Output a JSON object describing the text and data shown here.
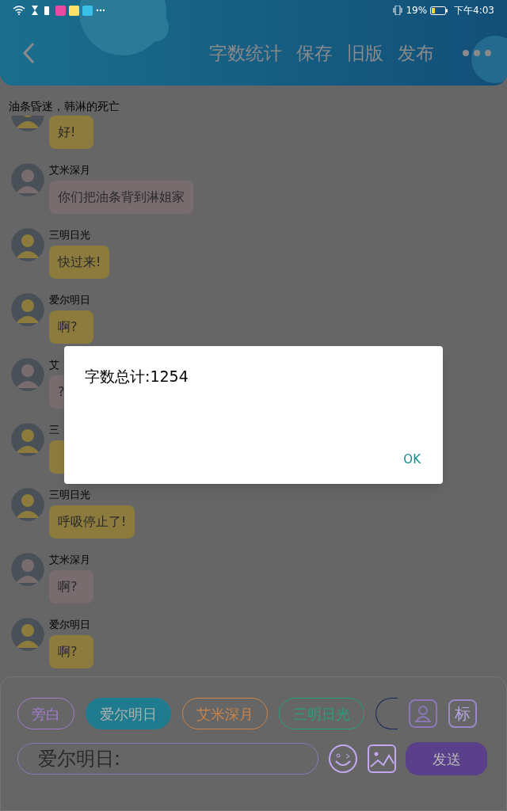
{
  "status_bar": {
    "battery": "19%",
    "time": "下午4:03"
  },
  "header": {
    "actions": [
      "字数统计",
      "保存",
      "旧版",
      "发布"
    ]
  },
  "chapter_title": "油条昏迷，韩淋的死亡",
  "messages": [
    {
      "text": "好!",
      "color": "#8c7b3c"
    },
    {
      "name": "艾米深月",
      "text": "你们把油条背到淋姐家",
      "color": "#786c6e"
    },
    {
      "name": "三明日光",
      "text": "快过来!",
      "color": "#8c7b3c"
    },
    {
      "name": "爱尔明日",
      "text": "啊?",
      "color": "#8c7b3c"
    },
    {
      "name": "艾",
      "text": "?",
      "color": "#786c6e"
    },
    {
      "name": "三",
      "color": "#8c7b3c"
    },
    {
      "name": "三明日光",
      "text": "呼吸停止了!",
      "color": "#8c7b3c"
    },
    {
      "name": "艾米深月",
      "text": "啊?",
      "color": "#786c6e"
    },
    {
      "name": "爱尔明日",
      "text": "啊?",
      "color": "#8c7b3c"
    }
  ],
  "roles": [
    {
      "label": "旁白",
      "color": "#a47ccc",
      "selected": false
    },
    {
      "label": "爱尔明日",
      "color": "#1f7c8e",
      "selected": true
    },
    {
      "label": "艾米深月",
      "color": "#cc8448",
      "selected": false
    },
    {
      "label": "三明日光",
      "color": "#26a07e",
      "selected": false
    },
    {
      "color": "#18265a",
      "selected": false
    }
  ],
  "side_buttons": [
    "标"
  ],
  "composer": {
    "placeholder": "爱尔明日:",
    "send": "发送"
  },
  "dialog": {
    "message": "字数总计:1254",
    "button": "OK"
  }
}
